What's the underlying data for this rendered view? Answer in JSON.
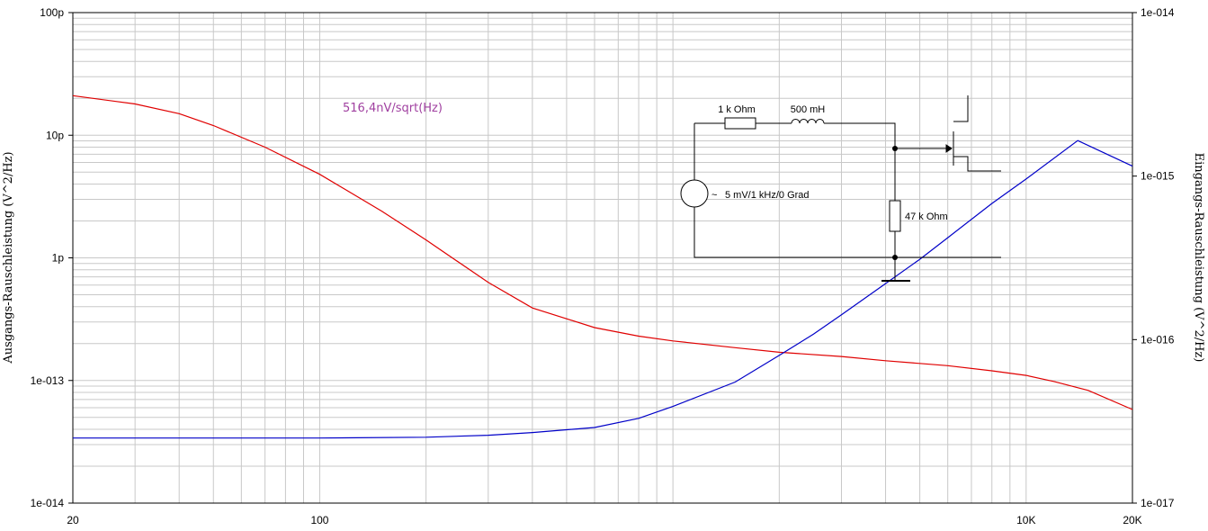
{
  "chart_data": {
    "type": "line",
    "x_scale": "log",
    "y_scale": "log",
    "y2_scale": "log",
    "xlim": [
      20,
      20000
    ],
    "ylim": [
      1e-14,
      1e-10
    ],
    "y2lim": [
      1e-17,
      1e-14
    ],
    "grid": true,
    "ylabel": "Ausgangs-Rauschleistung (V^2/Hz)",
    "y2label": "Eingangs-Rauschleistung (V^2/Hz)",
    "x_ticks": [
      {
        "value": 20,
        "label": "20"
      },
      {
        "value": 100,
        "label": "100"
      },
      {
        "value": 10000,
        "label": "10K"
      },
      {
        "value": 20000,
        "label": "20K"
      }
    ],
    "y_ticks": [
      {
        "value": 1e-14,
        "label": "1e-014"
      },
      {
        "value": 1e-13,
        "label": "1e-013"
      },
      {
        "value": 1e-12,
        "label": "1p"
      },
      {
        "value": 1e-11,
        "label": "10p"
      },
      {
        "value": 1e-10,
        "label": "100p"
      }
    ],
    "y2_ticks": [
      {
        "value": 1e-17,
        "label": "1e-017"
      },
      {
        "value": 1e-16,
        "label": "1e-016"
      },
      {
        "value": 1e-15,
        "label": "1e-015"
      },
      {
        "value": 1e-14,
        "label": "1e-014"
      }
    ],
    "series": [
      {
        "axis": "left",
        "color": "#e00000",
        "x": [
          20,
          30,
          40,
          50,
          70,
          100,
          150,
          200,
          300,
          400,
          600,
          800,
          1000,
          1500,
          2000,
          3000,
          4000,
          6000,
          8000,
          10000,
          12000,
          15000,
          20000
        ],
        "y": [
          2.1e-11,
          1.8e-11,
          1.5e-11,
          1.2e-11,
          8e-12,
          4.8e-12,
          2.4e-12,
          1.4e-12,
          6.3e-13,
          3.9e-13,
          2.7e-13,
          2.3e-13,
          2.1e-13,
          1.85e-13,
          1.7e-13,
          1.57e-13,
          1.45e-13,
          1.32e-13,
          1.2e-13,
          1.1e-13,
          9.8e-14,
          8.3e-14,
          5.8e-14
        ]
      },
      {
        "axis": "right",
        "color": "#0000c8",
        "x": [
          20,
          100,
          200,
          300,
          400,
          600,
          800,
          1000,
          1500,
          2000,
          2500,
          3000,
          4000,
          5000,
          6000,
          8000,
          10000,
          14000,
          20000
        ],
        "y": [
          2.5e-17,
          2.5e-17,
          2.53e-17,
          2.6e-17,
          2.7e-17,
          2.9e-17,
          3.3e-17,
          3.9e-17,
          5.5e-17,
          8e-17,
          1.08e-16,
          1.42e-16,
          2.2e-16,
          3.1e-16,
          4.2e-16,
          6.8e-16,
          9.6e-16,
          1.65e-15,
          1.15e-15
        ]
      }
    ],
    "annotation": {
      "text": "516,4nV/sqrt(Hz)",
      "color": "#a040a0"
    }
  },
  "circuit": {
    "r1_label": "1 k Ohm",
    "l1_label": "500 mH",
    "source_label": "5 mV/1 kHz/0 Grad",
    "r2_label": "47 k Ohm",
    "tilde": "~"
  }
}
